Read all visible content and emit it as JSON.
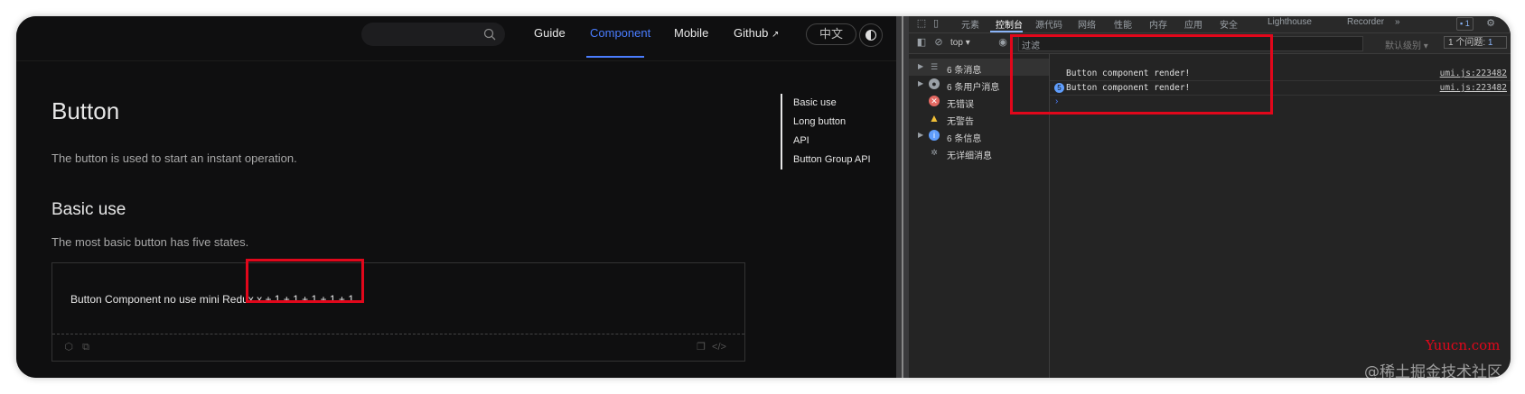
{
  "docs": {
    "nav": {
      "items": [
        "Guide",
        "Component",
        "Mobile",
        "Github"
      ],
      "active": "Component",
      "lang": "中文"
    },
    "title": "Button",
    "description": "The button is used to start an instant operation.",
    "section_title": "Basic use",
    "section_description": "The most basic button has five states.",
    "demo_text": "Button Component no use mini Redux x + 1 + 1 + 1 + 1 + 1",
    "toc": [
      "Basic use",
      "Long button",
      "API",
      "Button Group API"
    ]
  },
  "devtools": {
    "tabs": [
      "元素",
      "控制台",
      "源代码",
      "网络",
      "性能",
      "内存",
      "应用",
      "安全",
      "Lighthouse",
      "Recorder"
    ],
    "active_tab": "控制台",
    "badge_count": "1",
    "context": "top",
    "filter_placeholder": "过滤",
    "level": "默认级别",
    "issues": "1 个问题:",
    "issues_count": "1",
    "sidebar": [
      {
        "label": "6 条消息",
        "icon": "list-icon",
        "expandable": true
      },
      {
        "label": "6 条用户消息",
        "icon": "user-icon",
        "expandable": true
      },
      {
        "label": "无错误",
        "icon": "error-icon",
        "expandable": false
      },
      {
        "label": "无警告",
        "icon": "warning-icon",
        "expandable": false
      },
      {
        "label": "6 条信息",
        "icon": "info-icon",
        "expandable": true
      },
      {
        "label": "无详细消息",
        "icon": "verbose-icon",
        "expandable": false
      }
    ],
    "logs": [
      {
        "message": "Button component render!",
        "count": "",
        "source": "umi.js:223482"
      },
      {
        "message": "Button component render!",
        "count": "5",
        "source": "umi.js:223482"
      }
    ],
    "prompt": "›"
  },
  "watermark": {
    "site": "Yuucn.com",
    "author": "@稀土掘金技术社区"
  },
  "colors": {
    "accent": "#4a7dff",
    "highlight": "#e1071b"
  }
}
